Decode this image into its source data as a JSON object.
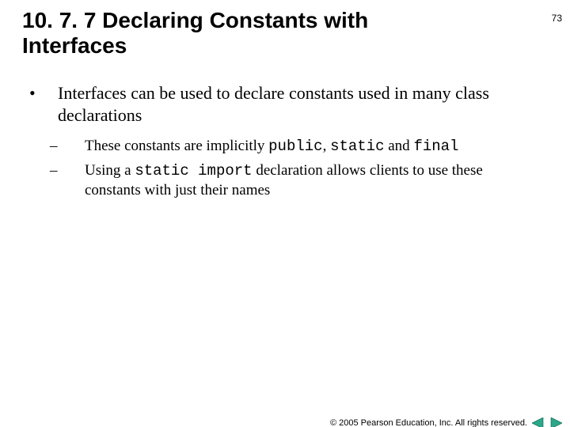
{
  "page_number": "73",
  "title": "10. 7. 7 Declaring Constants with Interfaces",
  "bullets": {
    "main": {
      "marker": "•",
      "text": "Interfaces can be used to declare constants used in many class declarations"
    },
    "subs": [
      {
        "dash": "–",
        "pre": "These constants are implicitly ",
        "code1": "public",
        "mid1": ", ",
        "code2": "static",
        "mid2": " and ",
        "code3": "final",
        "post": ""
      },
      {
        "dash": "–",
        "pre": "Using a ",
        "code1": "static import",
        "mid1": " declaration allows clients to use these constants with just their names",
        "code2": "",
        "mid2": "",
        "code3": "",
        "post": ""
      }
    ]
  },
  "footer": {
    "copyright": "© 2005 Pearson Education, Inc.  All rights reserved."
  },
  "icons": {
    "prev": "prev-triangle",
    "next": "next-triangle"
  }
}
